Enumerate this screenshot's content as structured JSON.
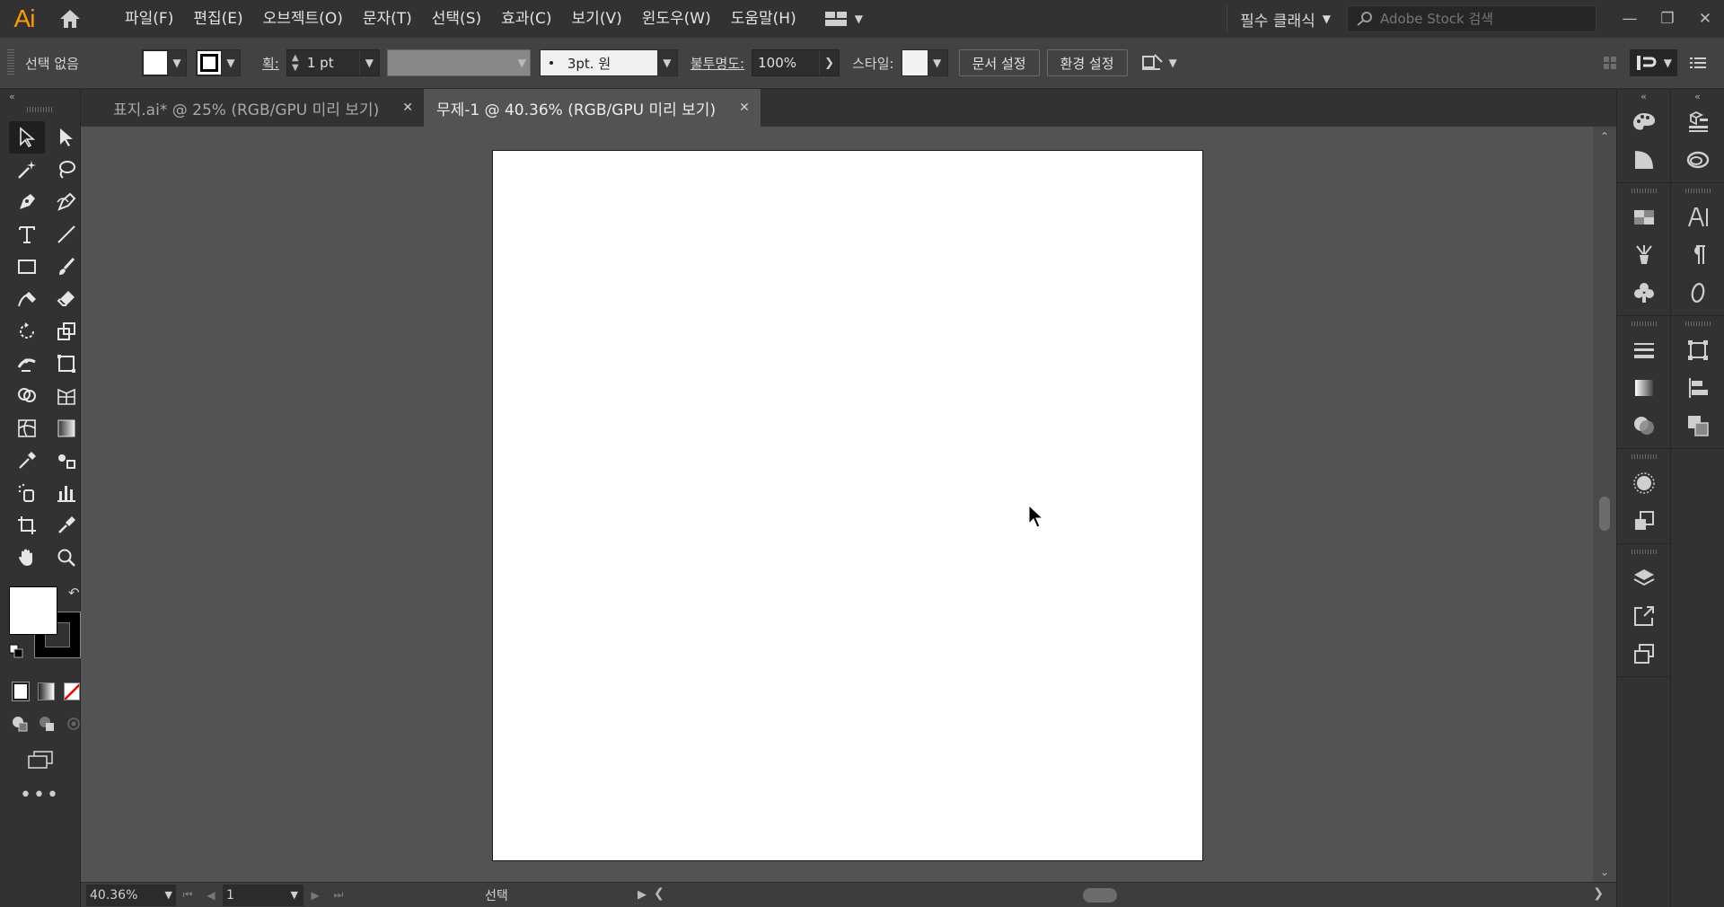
{
  "app": {
    "logo": "Ai",
    "menus": [
      "파일(F)",
      "편집(E)",
      "오브젝트(O)",
      "문자(T)",
      "선택(S)",
      "효과(C)",
      "보기(V)",
      "윈도우(W)",
      "도움말(H)"
    ],
    "workspace": "필수 클래식",
    "stock_search_placeholder": "Adobe Stock 검색"
  },
  "control": {
    "selection_state": "선택 없음",
    "stroke_label": "획:",
    "stroke_weight": "1 pt",
    "brush": "3pt. 원",
    "opacity_label": "불투명도:",
    "opacity": "100%",
    "style_label": "스타일:",
    "doc_setup": "문서 설정",
    "preferences": "환경 설정"
  },
  "tabs": [
    {
      "label": "표지.ai* @ 25% (RGB/GPU 미리 보기)",
      "active": false
    },
    {
      "label": "무제-1 @ 40.36% (RGB/GPU 미리 보기)",
      "active": true
    }
  ],
  "status": {
    "zoom": "40.36%",
    "artboard_number": "1",
    "tool_status": "선택"
  },
  "colors": {
    "accent_logo": "#ff9a00",
    "fill": "#ffffff",
    "stroke": "#000000"
  }
}
